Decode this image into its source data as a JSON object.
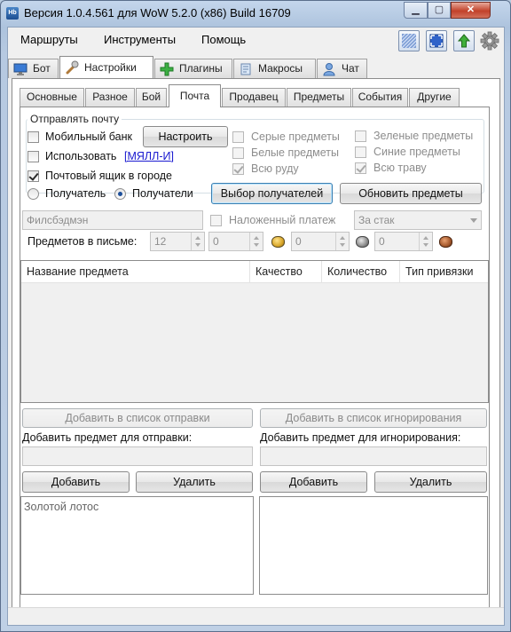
{
  "window": {
    "title": "Версия 1.0.4.561 для WoW 5.2.0 (x86) Build 16709",
    "app_icon_text": "Hb"
  },
  "menu": {
    "items": [
      "Маршруты",
      "Инструменты",
      "Помощь"
    ]
  },
  "toolbar": {
    "icons": [
      "grid-icon",
      "fullscreen-icon",
      "upload-arrow-icon",
      "gear-icon"
    ]
  },
  "main_tabs": [
    {
      "label": "Бот",
      "icon": "monitor-icon"
    },
    {
      "label": "Настройки",
      "icon": "wrench-icon",
      "active": true
    },
    {
      "label": "Плагины",
      "icon": "plus-icon"
    },
    {
      "label": "Макросы",
      "icon": "scroll-icon"
    },
    {
      "label": "Чат",
      "icon": "user-icon"
    }
  ],
  "sub_tabs": [
    {
      "label": "Основные"
    },
    {
      "label": "Разное"
    },
    {
      "label": "Бой"
    },
    {
      "label": "Почта",
      "active": true
    },
    {
      "label": "Продавец"
    },
    {
      "label": "Предметы"
    },
    {
      "label": "События"
    },
    {
      "label": "Другие"
    }
  ],
  "mail": {
    "group_title": "Отправлять почту",
    "mobile_bank": {
      "label": "Мобильный банк",
      "checked": false
    },
    "configure_button": "Настроить",
    "use": {
      "label": "Использовать",
      "link": "[МЯЛЛ-И]",
      "checked": false
    },
    "city_mailbox": {
      "label": "Почтовый ящик в городе",
      "checked": true
    },
    "recipient_radio": {
      "label": "Получатель",
      "checked": false
    },
    "recipients_radio": {
      "label": "Получатели",
      "checked": true
    },
    "select_recipients_button": "Выбор получателей",
    "recipient_value": "Филсбэдмэн",
    "qualities": [
      {
        "label": "Серые предметы",
        "checked": false
      },
      {
        "label": "Белые предметы",
        "checked": false
      },
      {
        "label": "Всю руду",
        "checked": true
      },
      {
        "label": "Зеленые предметы",
        "checked": false
      },
      {
        "label": "Синие предметы",
        "checked": false
      },
      {
        "label": "Всю траву",
        "checked": true
      }
    ],
    "update_items_button": "Обновить предметы",
    "cod": {
      "label": "Наложенный платеж",
      "checked": false
    },
    "cod_mode": "За стак",
    "items_per_mail_label": "Предметов в письме:",
    "items_per_mail": "12",
    "gold": "0",
    "silver": "0",
    "copper": "0",
    "coin_colors": {
      "gold": "#d9a72a",
      "silver": "#8d8d8d",
      "copper": "#a4582c"
    }
  },
  "items_table": {
    "columns": [
      "Название предмета",
      "Качество",
      "Количество",
      "Тип привязки"
    ],
    "rows": []
  },
  "actions": {
    "add_to_send_list": "Добавить в список отправки",
    "add_to_ignore_list": "Добавить в список игнорирования",
    "add_send_label": "Добавить предмет для отправки:",
    "add_ignore_label": "Добавить предмет для игнорирования:",
    "send_input": "",
    "ignore_input": "",
    "add_button": "Добавить",
    "remove_button": "Удалить"
  },
  "send_list": [
    "Золотой лотос"
  ],
  "ignore_list": []
}
